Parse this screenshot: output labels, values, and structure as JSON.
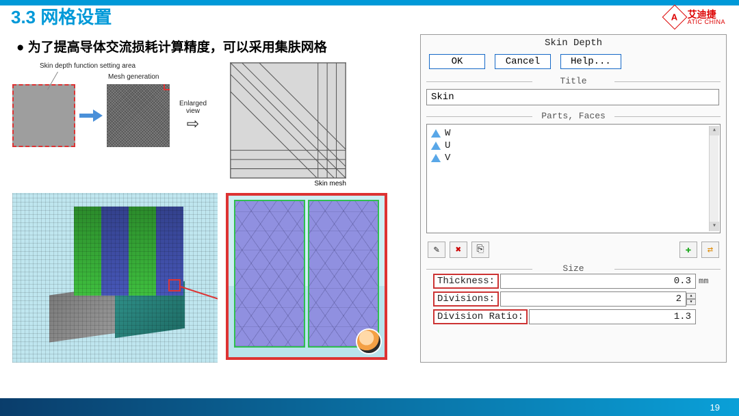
{
  "header": {
    "section_title": "3.3 网格设置",
    "logo_cn": "艾迪捷",
    "logo_en": "ATIC CHINA",
    "logo_mark": "A"
  },
  "bullet": "为了提高导体交流损耗计算精度，可以采用集肤网格",
  "schematic": {
    "label_area": "Skin depth function setting area",
    "label_meshgen": "Mesh generation",
    "label_enlarged": "Enlarged view",
    "label_skinmesh": "Skin mesh"
  },
  "dialog": {
    "title": "Skin Depth",
    "buttons": {
      "ok": "OK",
      "cancel": "Cancel",
      "help": "Help..."
    },
    "title_section": "Title",
    "title_value": "Skin",
    "parts_section": "Parts, Faces",
    "parts": [
      "W",
      "U",
      "V"
    ],
    "size_section": "Size",
    "fields": {
      "thickness_label": "Thickness:",
      "thickness_value": "0.3",
      "thickness_unit": "mm",
      "divisions_label": "Divisions:",
      "divisions_value": "2",
      "ratio_label": "Division Ratio:",
      "ratio_value": "1.3"
    },
    "tool_icons": {
      "edit": "✎",
      "delete": "✖",
      "copy": "⎘",
      "add": "✚",
      "swap": "⇄"
    }
  },
  "footer": {
    "page": "19"
  }
}
